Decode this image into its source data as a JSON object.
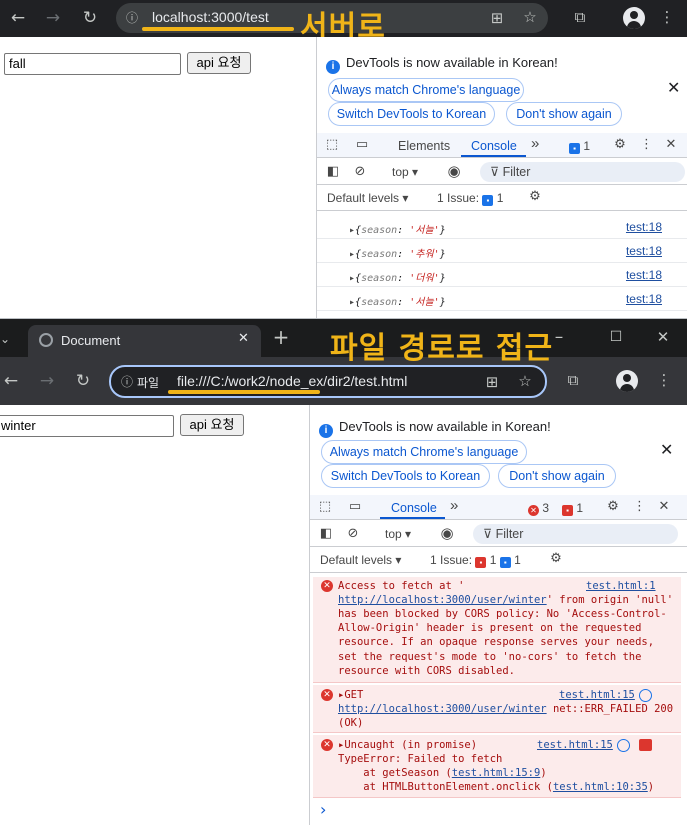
{
  "window1": {
    "url": "localhost:3000/test",
    "annotation": "서버로",
    "page": {
      "input_value": "fall",
      "button_label": "api 요청"
    },
    "devtools": {
      "banner": "DevTools is now available in Korean!",
      "btn_match": "Always match Chrome's language",
      "btn_switch": "Switch DevTools to Korean",
      "btn_dont": "Don't show again",
      "tabs": {
        "elements": "Elements",
        "console": "Console",
        "more": "»",
        "msg_count": "1"
      },
      "context": "top ▾",
      "filter_placeholder": "Filter",
      "levels": "Default levels ▾",
      "issues_label": "1 Issue:",
      "issues_count": "1",
      "logs": [
        {
          "key": "season",
          "value": "'서늘'",
          "link": "test:18"
        },
        {
          "key": "season",
          "value": "'추워'",
          "link": "test:18"
        },
        {
          "key": "season",
          "value": "'더워'",
          "link": "test:18"
        },
        {
          "key": "season",
          "value": "'서늘'",
          "link": "test:18"
        }
      ]
    }
  },
  "window2": {
    "tab_title": "Document",
    "annotation": "파일 경로로 접근",
    "url_prefix": "파일",
    "url": "file:///C:/work2/node_ex/dir2/test.html",
    "page": {
      "input_value": "winter",
      "button_label": "api 요청"
    },
    "devtools": {
      "banner": "DevTools is now available in Korean!",
      "btn_match": "Always match Chrome's language",
      "btn_switch": "Switch DevTools to Korean",
      "btn_dont": "Don't show again",
      "tabs": {
        "console": "Console",
        "more": "»",
        "error_count": "3",
        "issue_count": "1"
      },
      "context": "top ▾",
      "filter_placeholder": "Filter",
      "levels": "Default levels ▾",
      "issues_label": "1 Issue:",
      "issues_red": "1",
      "issues_blue": "1",
      "errors": [
        {
          "link": "test.html:1",
          "line1": "Access to fetch at '",
          "url": "http://localhost:3000/user/winter",
          "rest_first": "' from origin 'null'",
          "rest": "has been blocked by CORS policy: No 'Access-Control-\nAllow-Origin' header is present on the requested\nresource. If an opaque response serves your needs,\nset the request's mode to 'no-cors' to fetch the\nresource with CORS disabled."
        },
        {
          "link": "test.html:15",
          "line1": "▸GET",
          "url": "http://localhost:3000/user/winter",
          "url_tail": " net::ERR_FAILED 200",
          "rest": "(OK)"
        },
        {
          "link": "test.html:15",
          "line1": "▸Uncaught (in promise)",
          "line2": "TypeError: Failed to fetch",
          "at1_pre": "    at getSeason (",
          "at1_link": "test.html:15:9",
          "at1_post": ")",
          "at2_pre": "    at HTMLButtonElement.onclick (",
          "at2_link": "test.html:10:35",
          "at2_post": ")"
        }
      ],
      "prompt": "›"
    }
  },
  "colors": {
    "annotation": "#f0b418",
    "chrome_dark": "#202124",
    "link_blue": "#1f4fa0",
    "error_red": "#dc362e"
  }
}
